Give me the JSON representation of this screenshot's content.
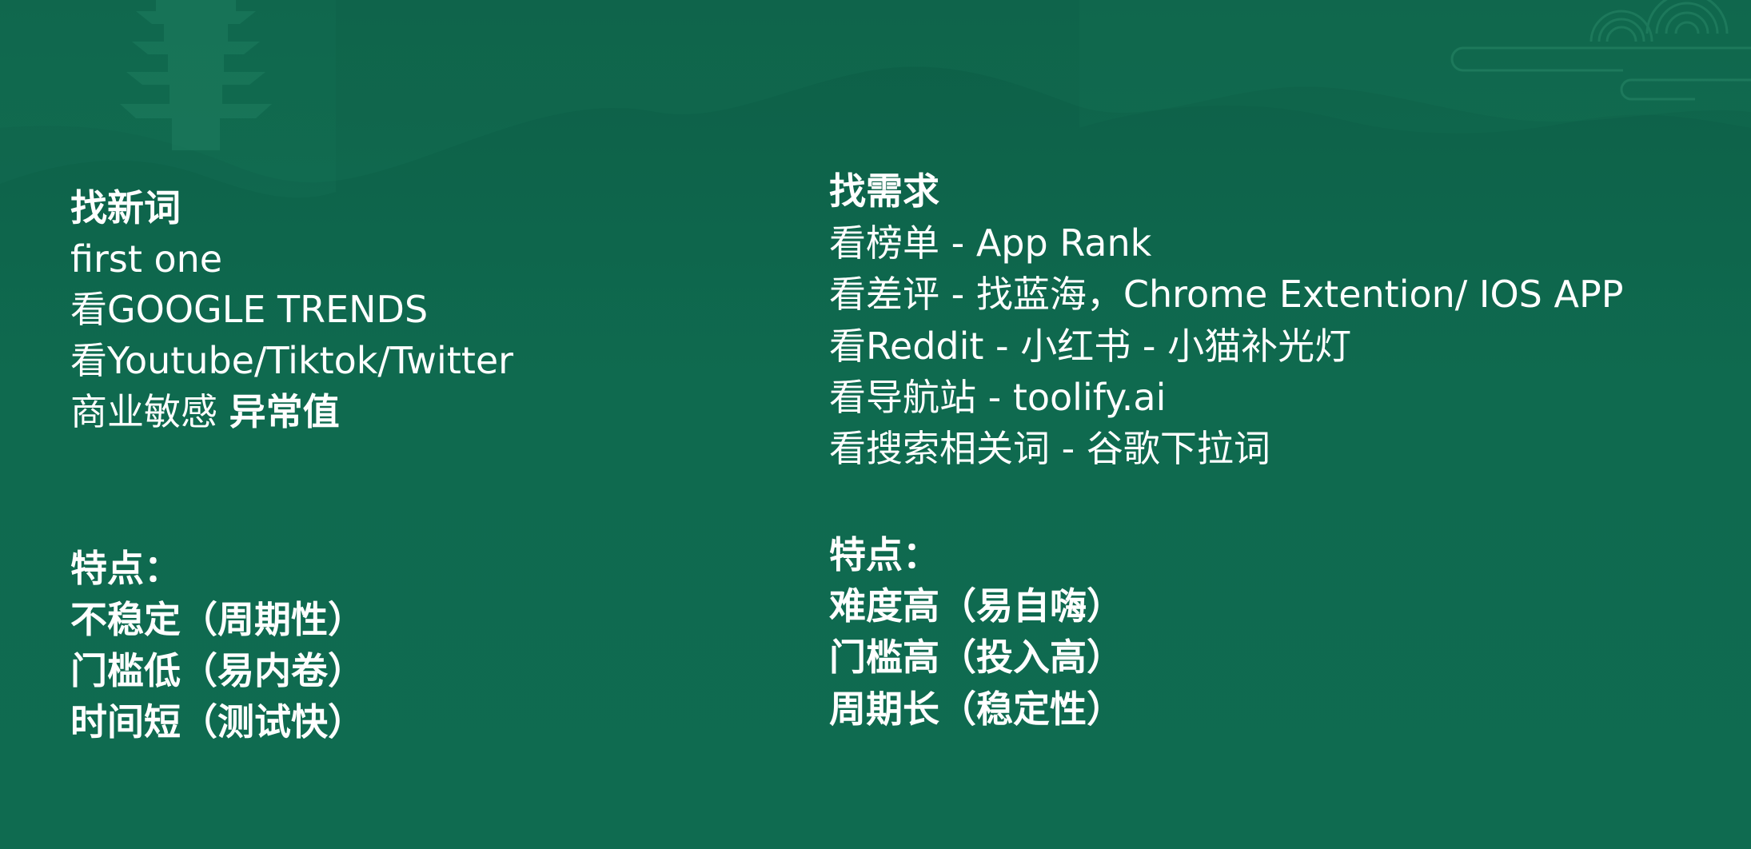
{
  "left_column": {
    "section1": {
      "heading": "找新词",
      "lines": [
        "first one",
        "看GOOGLE TRENDS",
        "看Youtube/Tiktok/Twitter"
      ],
      "last_line": {
        "normal": "商业敏感 ",
        "bold": "异常值"
      }
    },
    "section2": {
      "heading": "特点：",
      "lines": [
        "不稳定（周期性）",
        "门槛低（易内卷）",
        "时间短（测试快）"
      ]
    }
  },
  "right_column": {
    "section1": {
      "heading": "找需求",
      "lines": [
        "看榜单 - App Rank",
        "看差评 - 找蓝海，Chrome Extention/ IOS APP",
        "看Reddit - 小红书 - 小猫补光灯",
        "看导航站 - toolify.ai",
        "看搜索相关词 - 谷歌下拉词"
      ]
    },
    "section2": {
      "heading": "特点：",
      "lines": [
        "难度高（易自嗨）",
        "门槛高（投入高）",
        "周期长（稳定性）"
      ]
    }
  },
  "colors": {
    "background": "#0f6a4f",
    "text": "#ffffff"
  }
}
